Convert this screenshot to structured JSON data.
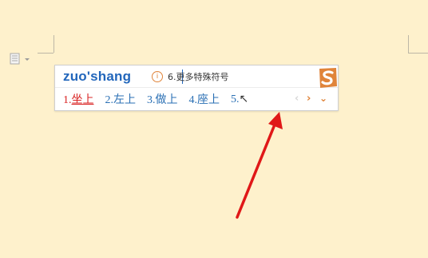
{
  "ime": {
    "composition": "zuo'shang",
    "hint_icon": "i",
    "hint_text": "6.更多特殊符号",
    "logo_icon": "sogou-logo-icon",
    "accent_color": "#e0843a",
    "candidates": [
      {
        "num": "1.",
        "word": "坐上",
        "selected": true
      },
      {
        "num": "2.",
        "word": "左上",
        "selected": false
      },
      {
        "num": "3.",
        "word": "做上",
        "selected": false
      },
      {
        "num": "4.",
        "word": "座上",
        "selected": false
      },
      {
        "num": "5.",
        "word": "↖",
        "selected": false
      }
    ],
    "pager": {
      "prev": "‹",
      "next": "›",
      "expand": "⌄"
    }
  },
  "colors": {
    "background": "#fef1cc",
    "candidate_text": "#2a6fb4",
    "selected_text": "#d92424",
    "arrow": "#e01818"
  }
}
